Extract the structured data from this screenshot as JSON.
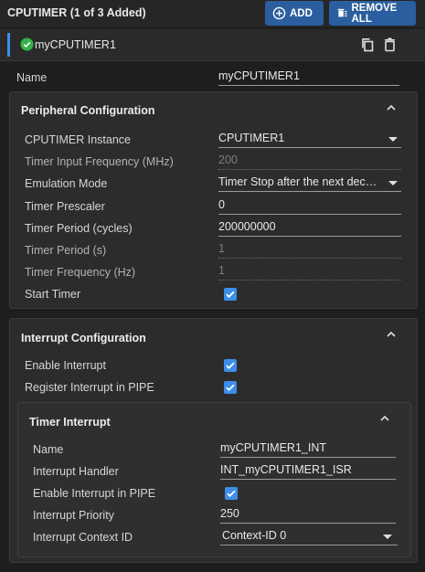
{
  "header": {
    "title": "CPUTIMER (1 of 3 Added)",
    "add_label": "ADD",
    "remove_all_label": "REMOVE ALL"
  },
  "item": {
    "name": "myCPUTIMER1"
  },
  "name_field": {
    "label": "Name",
    "value": "myCPUTIMER1"
  },
  "peripheral": {
    "title": "Peripheral Configuration",
    "rows": [
      {
        "label": "CPUTIMER Instance",
        "value": "CPUTIMER1"
      },
      {
        "label": "Timer Input Frequency (MHz)",
        "value": "200"
      },
      {
        "label": "Emulation Mode",
        "value": "Timer Stop after the next decrement"
      },
      {
        "label": "Timer Prescaler",
        "value": "0"
      },
      {
        "label": "Timer Period (cycles)",
        "value": "200000000"
      },
      {
        "label": "Timer Period (s)",
        "value": "1"
      },
      {
        "label": "Timer Frequency (Hz)",
        "value": "1"
      },
      {
        "label": "Start Timer",
        "checked": true
      }
    ]
  },
  "interrupt": {
    "title": "Interrupt Configuration",
    "enable_label": "Enable Interrupt",
    "enable_checked": true,
    "register_label": "Register Interrupt in PIPE",
    "register_checked": true,
    "timer_interrupt": {
      "title": "Timer Interrupt",
      "name_label": "Name",
      "name_value": "myCPUTIMER1_INT",
      "handler_label": "Interrupt Handler",
      "handler_value": "INT_myCPUTIMER1_ISR",
      "pipe_label": "Enable Interrupt in PIPE",
      "pipe_checked": true,
      "priority_label": "Interrupt Priority",
      "priority_value": "250",
      "context_label": "Interrupt Context ID",
      "context_value": "Context-ID 0"
    }
  },
  "colors": {
    "accent": "#3d8eea",
    "button": "#2b5e9e",
    "success": "#34b34a",
    "background": "#1e1e1e"
  },
  "icons": [
    "plus-circle-icon",
    "remove-all-icon",
    "check-circle-icon",
    "copy-icon",
    "trash-icon",
    "chevron-up-icon",
    "dropdown-arrow-icon",
    "checkbox-checked-icon"
  ]
}
